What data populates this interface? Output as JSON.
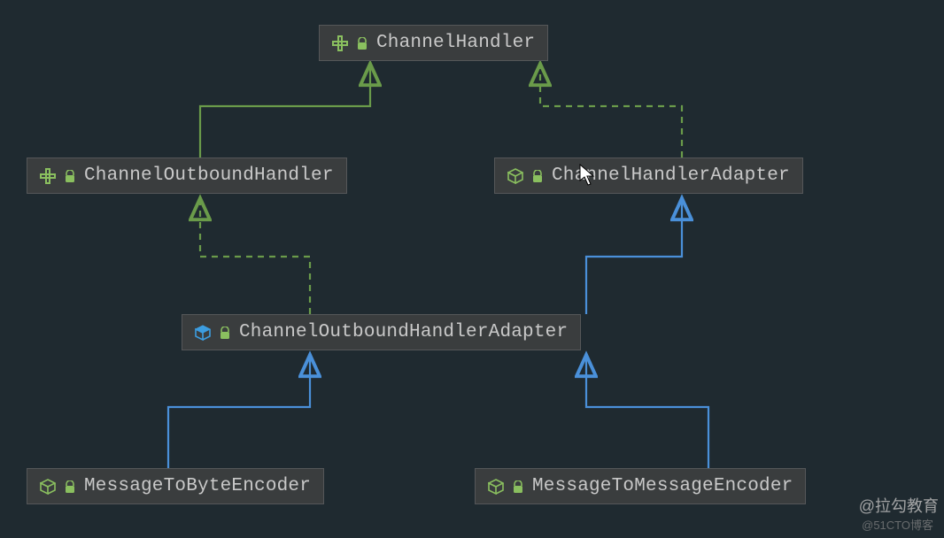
{
  "diagram": {
    "nodes": {
      "channelHandler": {
        "label": "ChannelHandler",
        "kind": "interface"
      },
      "channelOutboundHandler": {
        "label": "ChannelOutboundHandler",
        "kind": "interface"
      },
      "channelHandlerAdapter": {
        "label": "ChannelHandlerAdapter",
        "kind": "class",
        "iconColor": "green"
      },
      "channelOutboundHandlerAdapter": {
        "label": "ChannelOutboundHandlerAdapter",
        "kind": "class",
        "iconColor": "blue"
      },
      "messageToByteEncoder": {
        "label": "MessageToByteEncoder",
        "kind": "class",
        "iconColor": "green"
      },
      "messageToMessageEncoder": {
        "label": "MessageToMessageEncoder",
        "kind": "class",
        "iconColor": "green"
      }
    },
    "edges": [
      {
        "from": "channelOutboundHandler",
        "to": "channelHandler",
        "type": "extends",
        "style": "solid"
      },
      {
        "from": "channelHandlerAdapter",
        "to": "channelHandler",
        "type": "implements",
        "style": "dashed"
      },
      {
        "from": "channelOutboundHandlerAdapter",
        "to": "channelOutboundHandler",
        "type": "implements",
        "style": "dashed"
      },
      {
        "from": "channelOutboundHandlerAdapter",
        "to": "channelHandlerAdapter",
        "type": "extends",
        "style": "solid"
      },
      {
        "from": "messageToByteEncoder",
        "to": "channelOutboundHandlerAdapter",
        "type": "extends",
        "style": "solid"
      },
      {
        "from": "messageToMessageEncoder",
        "to": "channelOutboundHandlerAdapter",
        "type": "extends",
        "style": "solid"
      }
    ],
    "colors": {
      "interface": "#8abf5f",
      "classGreen": "#8abf5f",
      "classBlue": "#3c9de0",
      "extendsArrow": "#4a90d9",
      "implementsArrow": "#6a9b4a",
      "bg": "#1f2a30",
      "nodeBg": "#3a3d3e",
      "nodeBorder": "#555759",
      "text": "#c9c9c9"
    }
  },
  "watermark": {
    "primary": "@拉勾教育",
    "secondary": "@51CTO博客"
  }
}
